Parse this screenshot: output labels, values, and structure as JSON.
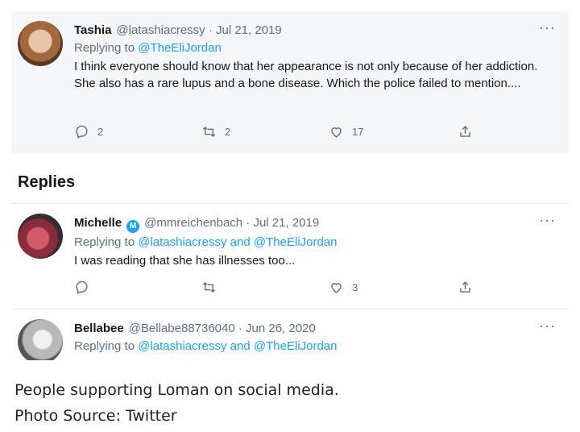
{
  "main_tweet": {
    "name": "Tashia",
    "handle_date": "@latashiacressy · Jul 21, 2019",
    "replying_prefix": "Replying to",
    "replying_to": "@TheEliJordan",
    "text": "I think everyone should know that her appearance is not only because of her addiction. She also has a rare lupus and a bone disease. Which the police failed to mention....",
    "reply_count": "2",
    "retweet_count": "2",
    "like_count": "17",
    "more": "···"
  },
  "replies_heading": "Replies",
  "replies": [
    {
      "name": "Michelle",
      "verified_letter": "M",
      "handle_date": "@mmreichenbach · Jul 21, 2019",
      "replying_prefix": "Replying to",
      "replying_to_1": "@latashiacressy",
      "and": "and",
      "replying_to_2": "@TheEliJordan",
      "text": "I was reading that she has illnesses too...",
      "reply_count": "",
      "retweet_count": "",
      "like_count": "3",
      "more": "···"
    },
    {
      "name": "Bellabee",
      "handle_date": "@Bellabe88736040 · Jun 26, 2020",
      "replying_prefix": "Replying to",
      "replying_to_1": "@latashiacressy",
      "and": "and",
      "replying_to_2": "@TheEliJordan",
      "more": "···"
    }
  ],
  "caption": {
    "line1": "People supporting Loman on social media.",
    "line2": "Photo Source: Twitter"
  },
  "icons": {
    "reply": "reply-icon",
    "retweet": "retweet-icon",
    "like": "heart-icon",
    "share": "share-icon",
    "more": "more-icon"
  },
  "colors": {
    "accent": "#1da1f2",
    "secondary_text": "#5b7083",
    "main_tweet_bg": "#f5f6f8"
  }
}
